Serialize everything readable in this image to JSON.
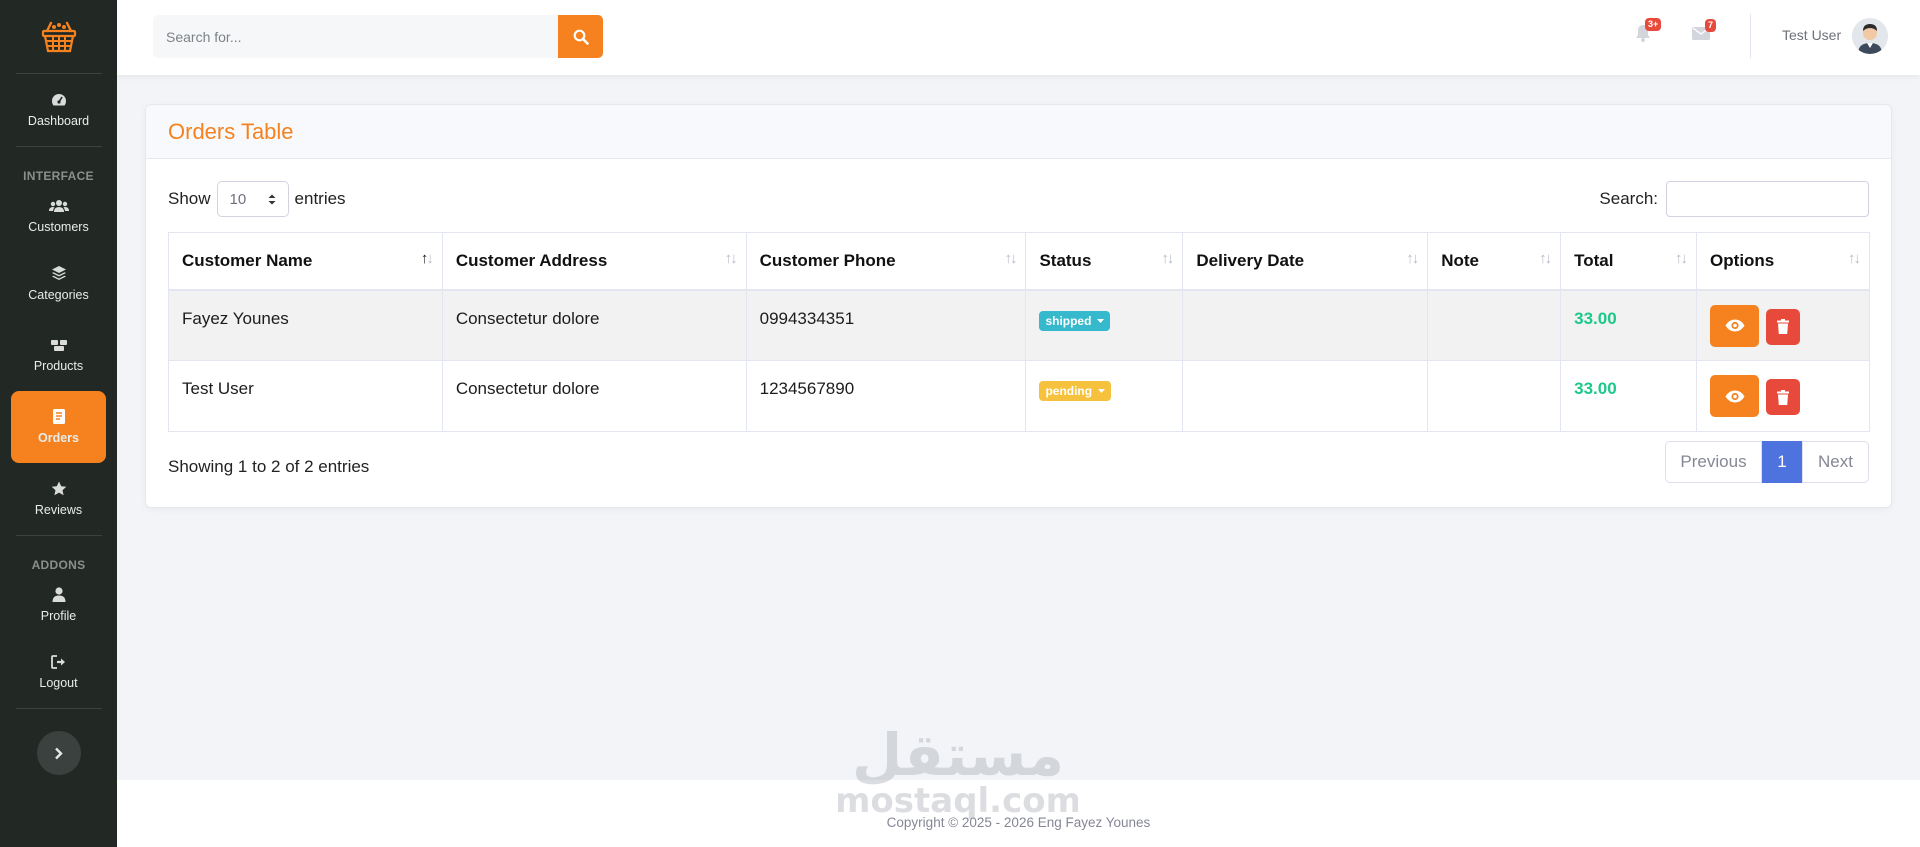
{
  "colors": {
    "accent": "#f5821f",
    "sidebar_bg": "#222925",
    "shipped": "#36b9cc",
    "pending": "#f6c23e",
    "danger": "#e74a3b",
    "success": "#1cc88a",
    "pagination_active": "#4e73df"
  },
  "sidebar": {
    "logo_icon": "shopping-basket-icon",
    "headings": {
      "interface": "INTERFACE",
      "addons": "ADDONS"
    },
    "items": [
      {
        "label": "Dashboard",
        "icon": "tachometer-icon"
      },
      {
        "label": "Customers",
        "icon": "users-icon"
      },
      {
        "label": "Categories",
        "icon": "layers-icon"
      },
      {
        "label": "Products",
        "icon": "boxes-icon"
      },
      {
        "label": "Orders",
        "icon": "clipboard-icon",
        "active": true
      },
      {
        "label": "Reviews",
        "icon": "star-icon"
      },
      {
        "label": "Profile",
        "icon": "user-icon"
      },
      {
        "label": "Logout",
        "icon": "sign-out-icon"
      }
    ]
  },
  "topbar": {
    "search_placeholder": "Search for...",
    "alerts_count": "3+",
    "messages_count": "7",
    "user_name": "Test User"
  },
  "card": {
    "title": "Orders Table",
    "show_label": "Show",
    "entries_value": "10",
    "entries_label": "entries",
    "search_label": "Search:"
  },
  "table": {
    "columns": [
      "Customer Name",
      "Customer Address",
      "Customer Phone",
      "Status",
      "Delivery Date",
      "Note",
      "Total",
      "Options"
    ],
    "rows": [
      {
        "name": "Fayez Younes",
        "address": "Consectetur dolore",
        "phone": "0994334351",
        "status": "shipped",
        "delivery_date": "",
        "note": "",
        "total": "33.00"
      },
      {
        "name": "Test User",
        "address": "Consectetur dolore",
        "phone": "1234567890",
        "status": "pending",
        "delivery_date": "",
        "note": "",
        "total": "33.00"
      }
    ]
  },
  "pagination": {
    "info": "Showing 1 to 2 of 2 entries",
    "previous": "Previous",
    "current": "1",
    "next": "Next"
  },
  "footer": {
    "copyright": "Copyright © 2025 - 2026 Eng Fayez Younes",
    "watermark_latin": "mostaql.com",
    "watermark_arabic": "مستقل"
  }
}
